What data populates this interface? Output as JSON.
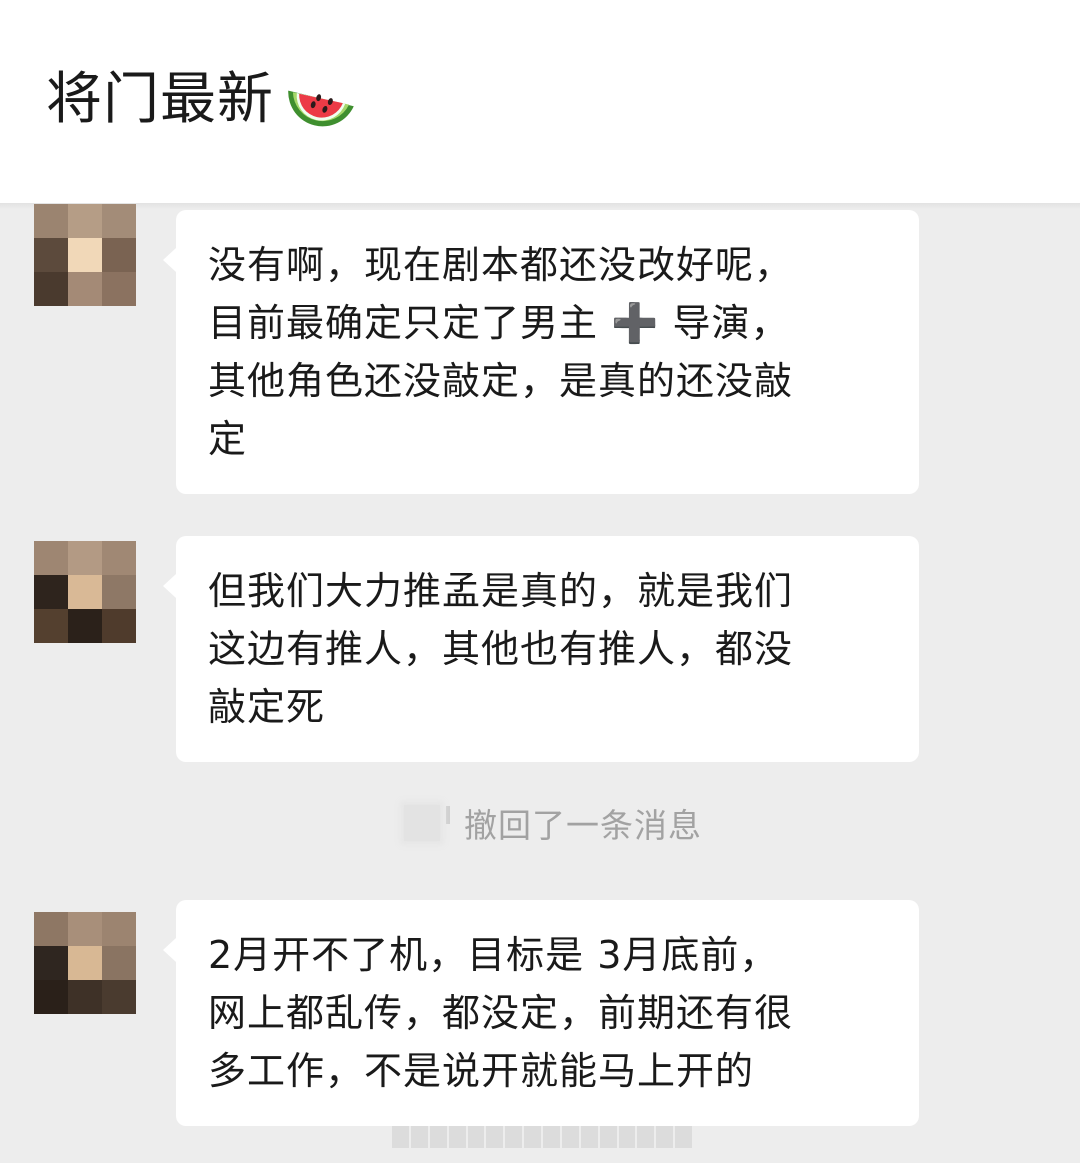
{
  "header": {
    "title": "将门最新",
    "emoji_icon": "watermelon-icon"
  },
  "messages": [
    {
      "lines": [
        "没有啊，现在剧本都还没改好呢，",
        "目前最确定只定了男主 ➕ 导演，",
        "其他角色还没敲定，是真的还没敲",
        "定"
      ]
    },
    {
      "lines": [
        "但我们大力推孟是真的，就是我们",
        "这边有推人，其他也有推人，都没",
        "敲定死"
      ]
    },
    {
      "lines": [
        "2月开不了机，目标是 3月底前，",
        "网上都乱传，都没定，前期还有很",
        "多工作，不是说开就能马上开的"
      ]
    }
  ],
  "recall_notice": {
    "text": "撤回了一条消息"
  },
  "colors": {
    "background": "#ededed",
    "bubble": "#ffffff",
    "header": "#ffffff",
    "system_text": "#a2a2a2"
  }
}
